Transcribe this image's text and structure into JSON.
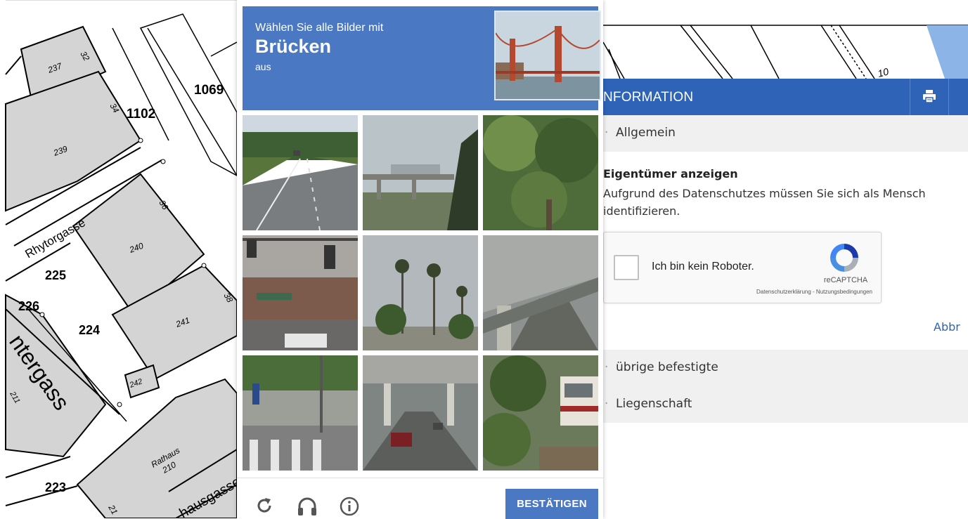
{
  "map": {
    "labels": {
      "p1069": "1069",
      "p1102": "1102",
      "p237": "237",
      "p32": "32",
      "p239": "239",
      "p34": "34",
      "p36": "36",
      "p240": "240",
      "p225": "225",
      "p226": "226",
      "p224": "224",
      "p241": "241",
      "p38": "38",
      "p242": "242",
      "p211": "211",
      "p223": "223",
      "p210": "210",
      "p21": "21",
      "rathaus": "Rathaus",
      "street_rhytorgasse": "Rhytorgasse",
      "street_untergass": "ntergass",
      "street_rathausgasse": "hausgasse",
      "top_strip_label": "10"
    }
  },
  "captcha": {
    "instruction_line1": "Wählen Sie alle Bilder mit",
    "target": "Brücken",
    "instruction_line3": "aus",
    "sample_image": "golden-gate-bridge",
    "tiles": [
      {
        "scene": "highway"
      },
      {
        "scene": "elevated-train-bridge"
      },
      {
        "scene": "trees"
      },
      {
        "scene": "traffic-light-intersection"
      },
      {
        "scene": "palm-trees"
      },
      {
        "scene": "under-overpass"
      },
      {
        "scene": "street-crosswalk"
      },
      {
        "scene": "road-under-overpass"
      },
      {
        "scene": "trees-and-bus"
      }
    ],
    "footer": {
      "reload_icon": "reload-icon",
      "audio_icon": "headphones-icon",
      "info_icon": "info-icon",
      "confirm_label": "BESTÄTIGEN"
    },
    "colors": {
      "header": "#4a78c2",
      "button": "#4a78c2"
    }
  },
  "info_panel": {
    "title": "NFORMATION",
    "print_icon": "print-icon",
    "extra_header_glyph": " ",
    "sections": {
      "allgemein": "Allgemein",
      "befestigte": "übrige befestigte",
      "liegenschaft": "Liegenschaft"
    },
    "owner_title": "Eigentümer anzeigen",
    "owner_text": "Aufgrund des Datenschutzes müssen Sie sich als Mensch identifizieren.",
    "recaptcha": {
      "checkbox_label": "Ich bin kein Roboter.",
      "brand": "reCAPTCHA",
      "links": "Datenschutzerklärung - Nutzungsbedingungen"
    },
    "cancel": "Abbr",
    "colors": {
      "header": "#2e63b8",
      "link": "#2e63b8"
    }
  }
}
